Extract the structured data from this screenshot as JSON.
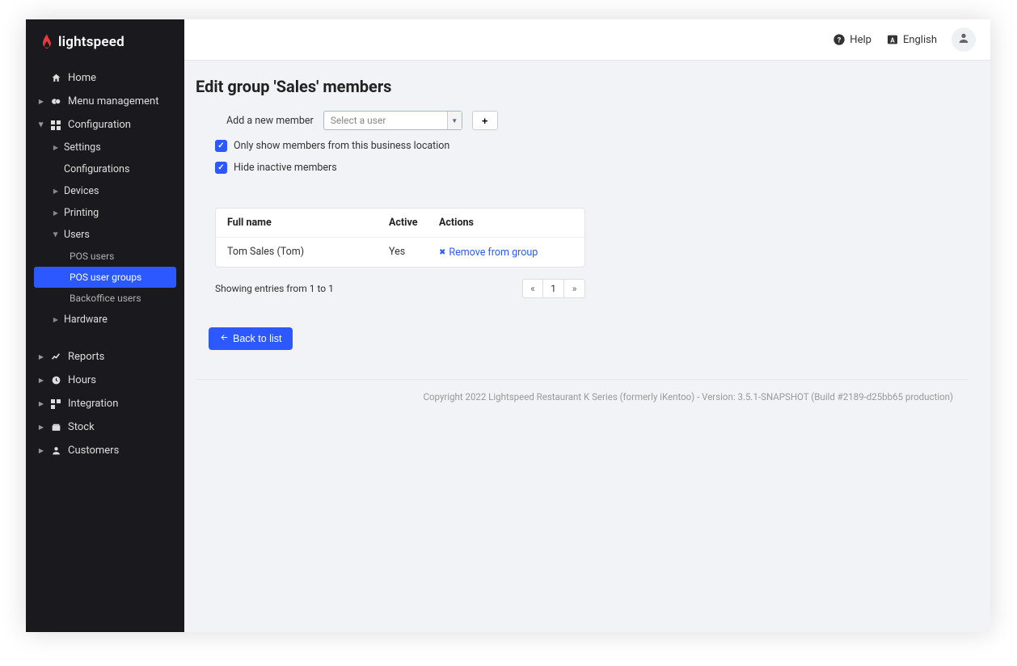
{
  "brand": "lightspeed",
  "header": {
    "help": "Help",
    "language": "English"
  },
  "sidebar": {
    "home": "Home",
    "menu_management": "Menu management",
    "configuration": "Configuration",
    "settings": "Settings",
    "configurations": "Configurations",
    "devices": "Devices",
    "printing": "Printing",
    "users": "Users",
    "pos_users": "POS users",
    "pos_user_groups": "POS user groups",
    "backoffice_users": "Backoffice users",
    "hardware": "Hardware",
    "reports": "Reports",
    "hours": "Hours",
    "integration": "Integration",
    "stock": "Stock",
    "customers": "Customers"
  },
  "page": {
    "title": "Edit group 'Sales' members",
    "add_member_label": "Add a new member",
    "select_placeholder": "Select a user",
    "check1": "Only show members from this business location",
    "check2": "Hide inactive members"
  },
  "table": {
    "col_fullname": "Full name",
    "col_active": "Active",
    "col_actions": "Actions",
    "rows": [
      {
        "name": "Tom Sales (Tom)",
        "active": "Yes",
        "action": "Remove from group"
      }
    ],
    "showing": "Showing entries from 1 to 1",
    "page_current": "1"
  },
  "back_btn": "Back to list",
  "footer": "Copyright 2022 Lightspeed Restaurant K Series (formerly iKentoo) - Version: 3.5.1-SNAPSHOT (Build #2189-d25bb65 production)"
}
